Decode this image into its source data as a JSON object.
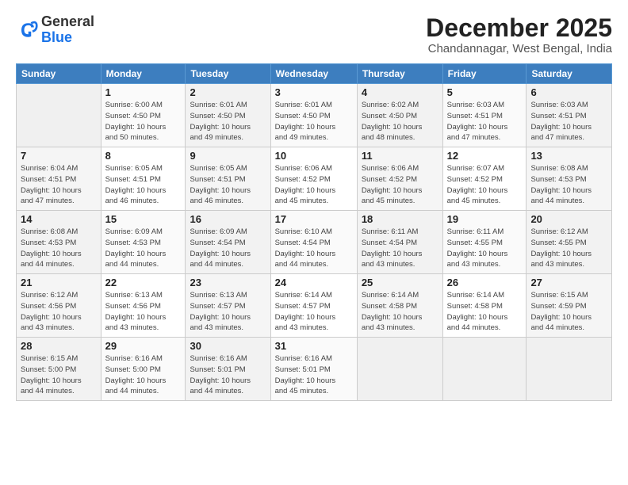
{
  "header": {
    "logo_line1": "General",
    "logo_line2": "Blue",
    "month": "December 2025",
    "location": "Chandannagar, West Bengal, India"
  },
  "weekdays": [
    "Sunday",
    "Monday",
    "Tuesday",
    "Wednesday",
    "Thursday",
    "Friday",
    "Saturday"
  ],
  "weeks": [
    [
      {
        "day": "",
        "info": ""
      },
      {
        "day": "1",
        "info": "Sunrise: 6:00 AM\nSunset: 4:50 PM\nDaylight: 10 hours\nand 50 minutes."
      },
      {
        "day": "2",
        "info": "Sunrise: 6:01 AM\nSunset: 4:50 PM\nDaylight: 10 hours\nand 49 minutes."
      },
      {
        "day": "3",
        "info": "Sunrise: 6:01 AM\nSunset: 4:50 PM\nDaylight: 10 hours\nand 49 minutes."
      },
      {
        "day": "4",
        "info": "Sunrise: 6:02 AM\nSunset: 4:50 PM\nDaylight: 10 hours\nand 48 minutes."
      },
      {
        "day": "5",
        "info": "Sunrise: 6:03 AM\nSunset: 4:51 PM\nDaylight: 10 hours\nand 47 minutes."
      },
      {
        "day": "6",
        "info": "Sunrise: 6:03 AM\nSunset: 4:51 PM\nDaylight: 10 hours\nand 47 minutes."
      }
    ],
    [
      {
        "day": "7",
        "info": "Sunrise: 6:04 AM\nSunset: 4:51 PM\nDaylight: 10 hours\nand 47 minutes."
      },
      {
        "day": "8",
        "info": "Sunrise: 6:05 AM\nSunset: 4:51 PM\nDaylight: 10 hours\nand 46 minutes."
      },
      {
        "day": "9",
        "info": "Sunrise: 6:05 AM\nSunset: 4:51 PM\nDaylight: 10 hours\nand 46 minutes."
      },
      {
        "day": "10",
        "info": "Sunrise: 6:06 AM\nSunset: 4:52 PM\nDaylight: 10 hours\nand 45 minutes."
      },
      {
        "day": "11",
        "info": "Sunrise: 6:06 AM\nSunset: 4:52 PM\nDaylight: 10 hours\nand 45 minutes."
      },
      {
        "day": "12",
        "info": "Sunrise: 6:07 AM\nSunset: 4:52 PM\nDaylight: 10 hours\nand 45 minutes."
      },
      {
        "day": "13",
        "info": "Sunrise: 6:08 AM\nSunset: 4:53 PM\nDaylight: 10 hours\nand 44 minutes."
      }
    ],
    [
      {
        "day": "14",
        "info": "Sunrise: 6:08 AM\nSunset: 4:53 PM\nDaylight: 10 hours\nand 44 minutes."
      },
      {
        "day": "15",
        "info": "Sunrise: 6:09 AM\nSunset: 4:53 PM\nDaylight: 10 hours\nand 44 minutes."
      },
      {
        "day": "16",
        "info": "Sunrise: 6:09 AM\nSunset: 4:54 PM\nDaylight: 10 hours\nand 44 minutes."
      },
      {
        "day": "17",
        "info": "Sunrise: 6:10 AM\nSunset: 4:54 PM\nDaylight: 10 hours\nand 44 minutes."
      },
      {
        "day": "18",
        "info": "Sunrise: 6:11 AM\nSunset: 4:54 PM\nDaylight: 10 hours\nand 43 minutes."
      },
      {
        "day": "19",
        "info": "Sunrise: 6:11 AM\nSunset: 4:55 PM\nDaylight: 10 hours\nand 43 minutes."
      },
      {
        "day": "20",
        "info": "Sunrise: 6:12 AM\nSunset: 4:55 PM\nDaylight: 10 hours\nand 43 minutes."
      }
    ],
    [
      {
        "day": "21",
        "info": "Sunrise: 6:12 AM\nSunset: 4:56 PM\nDaylight: 10 hours\nand 43 minutes."
      },
      {
        "day": "22",
        "info": "Sunrise: 6:13 AM\nSunset: 4:56 PM\nDaylight: 10 hours\nand 43 minutes."
      },
      {
        "day": "23",
        "info": "Sunrise: 6:13 AM\nSunset: 4:57 PM\nDaylight: 10 hours\nand 43 minutes."
      },
      {
        "day": "24",
        "info": "Sunrise: 6:14 AM\nSunset: 4:57 PM\nDaylight: 10 hours\nand 43 minutes."
      },
      {
        "day": "25",
        "info": "Sunrise: 6:14 AM\nSunset: 4:58 PM\nDaylight: 10 hours\nand 43 minutes."
      },
      {
        "day": "26",
        "info": "Sunrise: 6:14 AM\nSunset: 4:58 PM\nDaylight: 10 hours\nand 44 minutes."
      },
      {
        "day": "27",
        "info": "Sunrise: 6:15 AM\nSunset: 4:59 PM\nDaylight: 10 hours\nand 44 minutes."
      }
    ],
    [
      {
        "day": "28",
        "info": "Sunrise: 6:15 AM\nSunset: 5:00 PM\nDaylight: 10 hours\nand 44 minutes."
      },
      {
        "day": "29",
        "info": "Sunrise: 6:16 AM\nSunset: 5:00 PM\nDaylight: 10 hours\nand 44 minutes."
      },
      {
        "day": "30",
        "info": "Sunrise: 6:16 AM\nSunset: 5:01 PM\nDaylight: 10 hours\nand 44 minutes."
      },
      {
        "day": "31",
        "info": "Sunrise: 6:16 AM\nSunset: 5:01 PM\nDaylight: 10 hours\nand 45 minutes."
      },
      {
        "day": "",
        "info": ""
      },
      {
        "day": "",
        "info": ""
      },
      {
        "day": "",
        "info": ""
      }
    ]
  ]
}
